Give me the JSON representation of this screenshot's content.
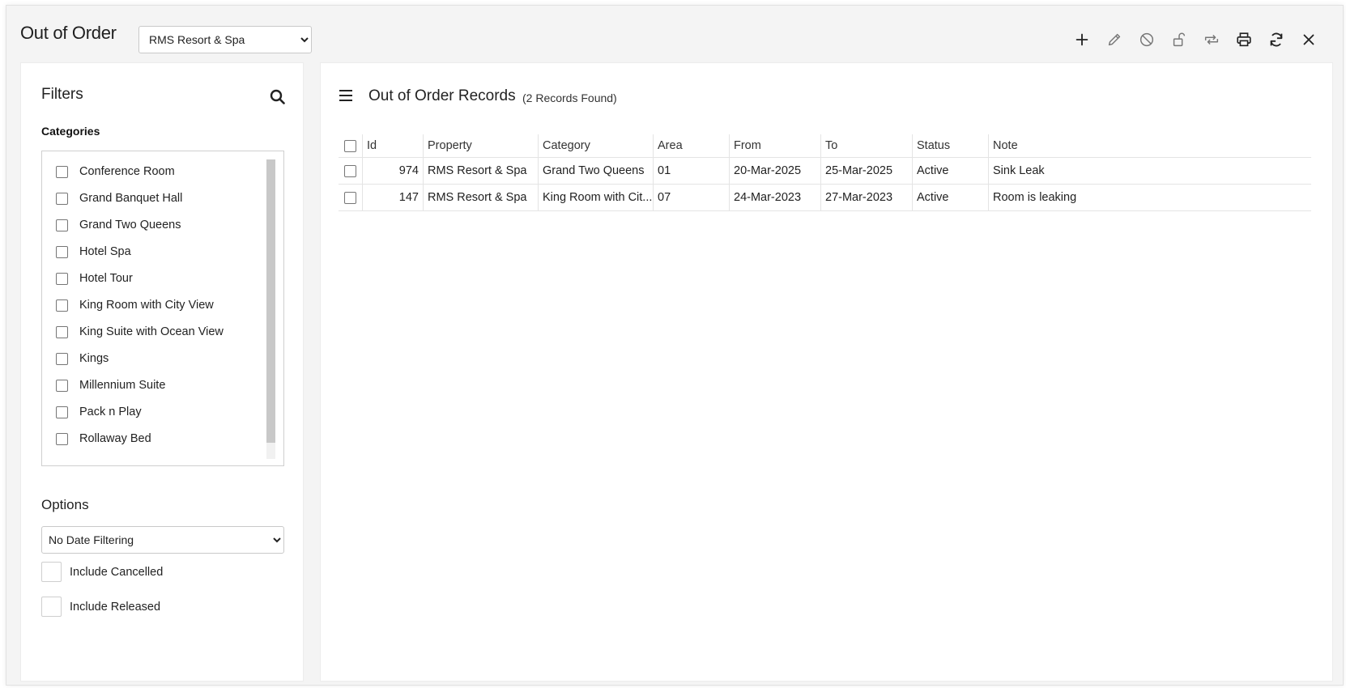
{
  "header": {
    "title": "Out of Order",
    "property_selected": "RMS Resort & Spa",
    "toolbar": [
      "add-icon",
      "edit-icon",
      "cancel-icon",
      "release-icon",
      "change-icon",
      "print-icon",
      "refresh-icon",
      "close-icon"
    ]
  },
  "filters": {
    "title": "Filters",
    "categories_label": "Categories",
    "categories": [
      "Conference Room",
      "Grand Banquet Hall",
      "Grand Two Queens",
      "Hotel Spa",
      "Hotel Tour",
      "King Room with City View",
      "King Suite with Ocean View",
      "Kings",
      "Millennium Suite",
      "Pack n Play",
      "Rollaway Bed"
    ],
    "options_label": "Options",
    "date_filter_selected": "No Date Filtering",
    "include_cancelled": "Include Cancelled",
    "include_released": "Include Released"
  },
  "records": {
    "title": "Out of Order Records",
    "count": "(2 Records Found)",
    "columns": [
      "Id",
      "Property",
      "Category",
      "Area",
      "From",
      "To",
      "Status",
      "Note"
    ],
    "rows": [
      {
        "id": "974",
        "property": "RMS Resort & Spa",
        "category": "Grand Two Queens",
        "area": "01",
        "from": "20-Mar-2025",
        "to": "25-Mar-2025",
        "status": "Active",
        "note": "Sink Leak"
      },
      {
        "id": "147",
        "property": "RMS Resort & Spa",
        "category": "King Room with Cit...",
        "area": "07",
        "from": "24-Mar-2023",
        "to": "27-Mar-2023",
        "status": "Active",
        "note": "Room is leaking"
      }
    ]
  }
}
